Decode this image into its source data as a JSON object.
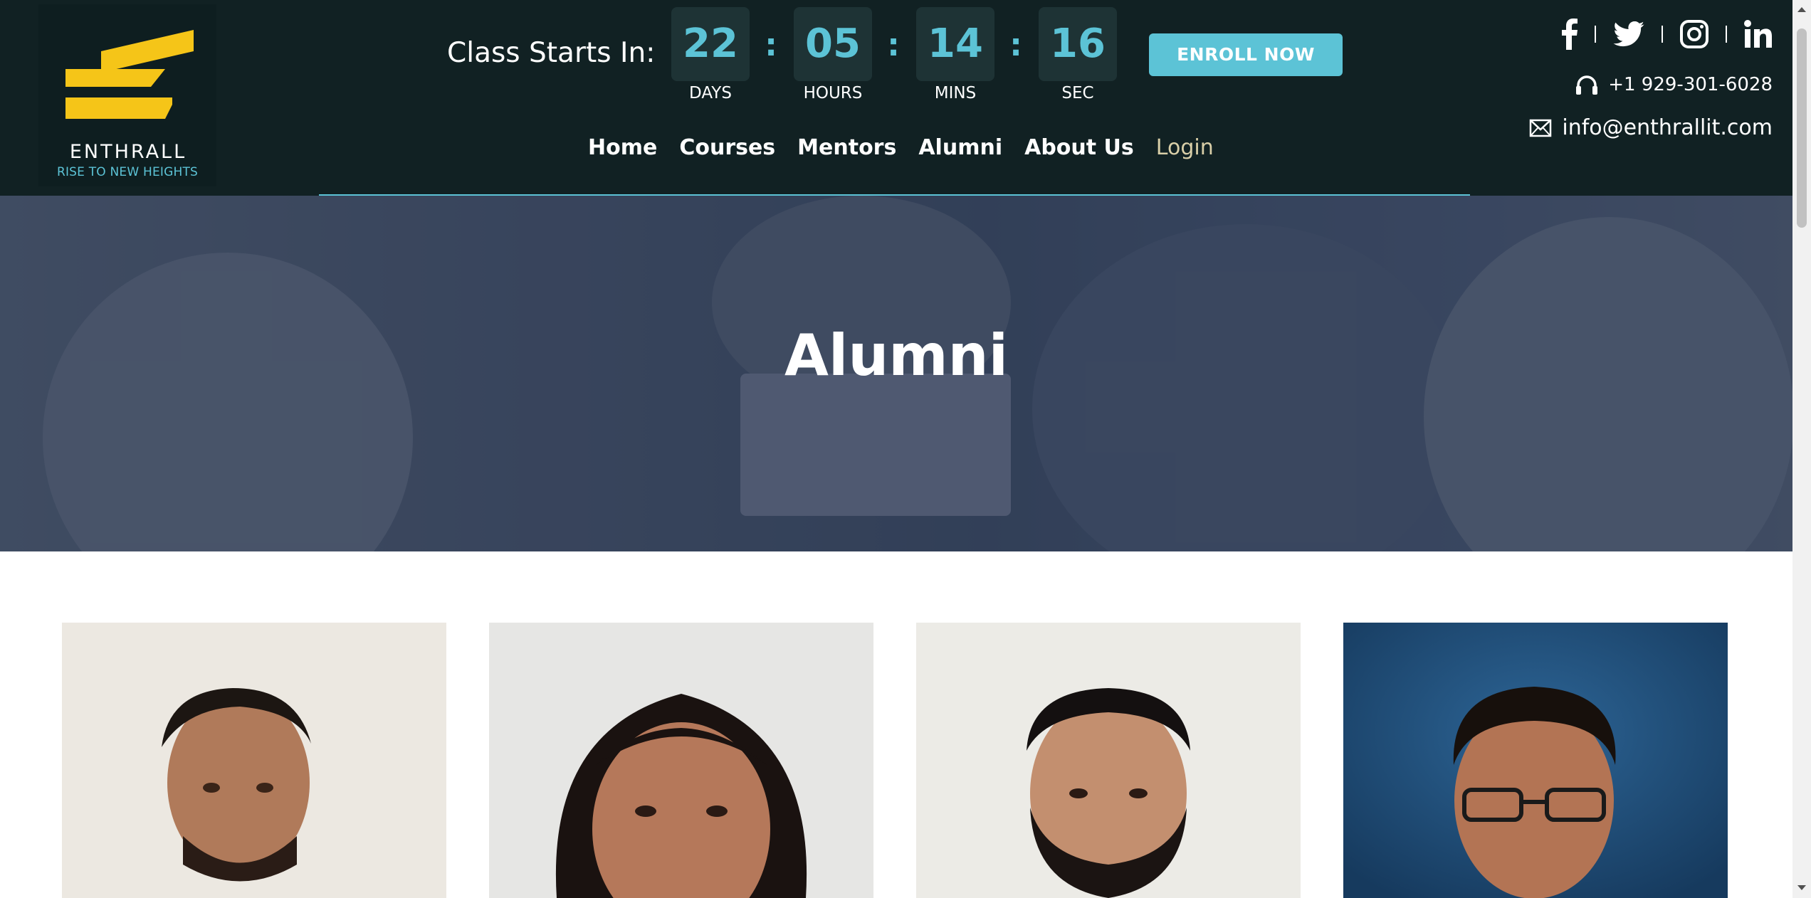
{
  "brand": {
    "name": "ENTHRALL",
    "tagline": "RISE TO NEW HEIGHTS",
    "logo_color": "#F5C518",
    "accent_color": "#5CC3D6"
  },
  "countdown": {
    "label": "Class Starts In:",
    "days": "22",
    "hours": "05",
    "mins": "14",
    "sec": "16",
    "days_unit": "DAYS",
    "hours_unit": "HOURS",
    "mins_unit": "MINS",
    "sec_unit": "SEC",
    "separator": ":"
  },
  "enroll_button": "ENROLL NOW",
  "nav": {
    "items": [
      "Home",
      "Courses",
      "Mentors",
      "Alumni",
      "About Us",
      "Login"
    ]
  },
  "socials": [
    "facebook-icon",
    "twitter-icon",
    "instagram-icon",
    "linkedin-icon"
  ],
  "contact": {
    "phone": "+1 929-301-6028",
    "email": "info@enthrallit.com"
  },
  "hero": {
    "title": "Alumni"
  },
  "alumni_cards": [
    {
      "photo": "alumni-photo-1"
    },
    {
      "photo": "alumni-photo-2"
    },
    {
      "photo": "alumni-photo-3"
    },
    {
      "photo": "alumni-photo-4"
    }
  ]
}
